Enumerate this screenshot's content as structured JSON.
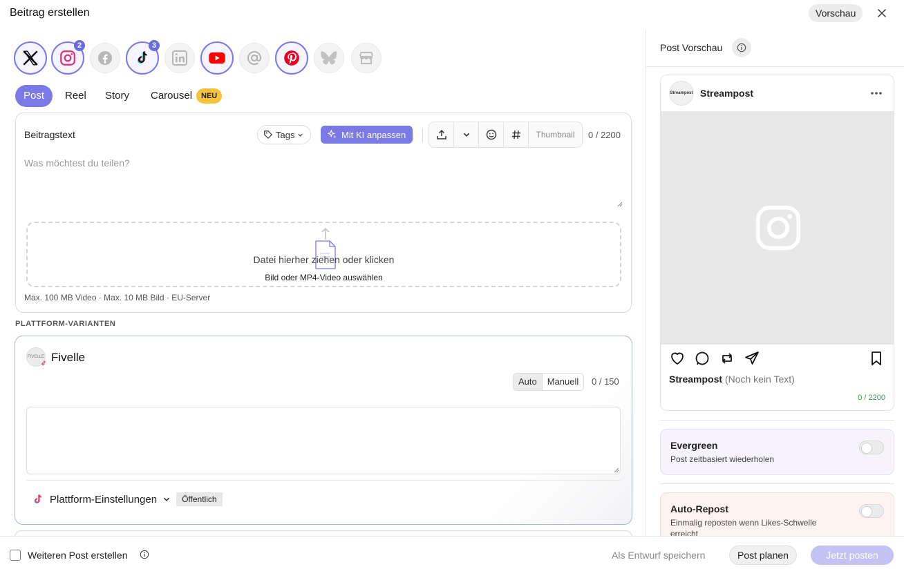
{
  "header": {
    "title": "Beitrag erstellen",
    "preview_label": "Vorschau"
  },
  "platforms": [
    {
      "name": "X",
      "selected": true,
      "badge": ""
    },
    {
      "name": "Instagram",
      "selected": true,
      "badge": "2"
    },
    {
      "name": "Facebook",
      "selected": false,
      "badge": ""
    },
    {
      "name": "TikTok",
      "selected": true,
      "badge": "3"
    },
    {
      "name": "LinkedIn",
      "selected": false,
      "badge": ""
    },
    {
      "name": "YouTube",
      "selected": true,
      "badge": ""
    },
    {
      "name": "Threads",
      "selected": false,
      "badge": ""
    },
    {
      "name": "Pinterest",
      "selected": true,
      "badge": ""
    },
    {
      "name": "Bluesky",
      "selected": false,
      "badge": ""
    },
    {
      "name": "Google Business",
      "selected": false,
      "badge": ""
    }
  ],
  "tabs": {
    "post": "Post",
    "reel": "Reel",
    "story": "Story",
    "carousel": "Carousel",
    "new_badge": "NEU"
  },
  "composer": {
    "title": "Beitragstext",
    "tags_label": "Tags",
    "ai_label": "Mit KI anpassen",
    "thumbnail_label": "Thumbnail",
    "counter": "0 / 2200",
    "placeholder": "Was möchtest du teilen?",
    "dropzone_main": "Datei hierher ziehen oder klicken",
    "dropzone_sub": "Bild oder MP4-Video auswählen",
    "hint": "Max. 100 MB Video · Max. 10 MB Bild · EU-Server"
  },
  "variants": {
    "section_label": "PLATTFORM-VARIANTEN",
    "item": {
      "avatar_text": "FIVELLE",
      "name": "Fivelle",
      "mode_auto": "Auto",
      "mode_manual": "Manuell",
      "counter": "0 / 150",
      "settings_label": "Plattform-Einstellungen",
      "visibility": "Öffentlich"
    }
  },
  "preview": {
    "title": "Post Vorschau",
    "avatar_text": "Streampost",
    "account": "Streampost",
    "caption_name": "Streampost",
    "caption_text": "(Noch kein Text)",
    "counter": "0 / 2200"
  },
  "options": {
    "evergreen": {
      "title": "Evergreen",
      "sub": "Post zeitbasiert wiederholen",
      "enabled": false
    },
    "autorepost": {
      "title": "Auto-Repost",
      "sub": "Einmalig reposten wenn Likes-Schwelle erreicht",
      "enabled": false
    }
  },
  "footer": {
    "another_label": "Weiteren Post erstellen",
    "draft_label": "Als Entwurf speichern",
    "plan_label": "Post planen",
    "post_now_label": "Jetzt posten"
  },
  "colors": {
    "accent": "#7b79e6",
    "badge": "#f7c33a",
    "success": "#3a9a56"
  }
}
